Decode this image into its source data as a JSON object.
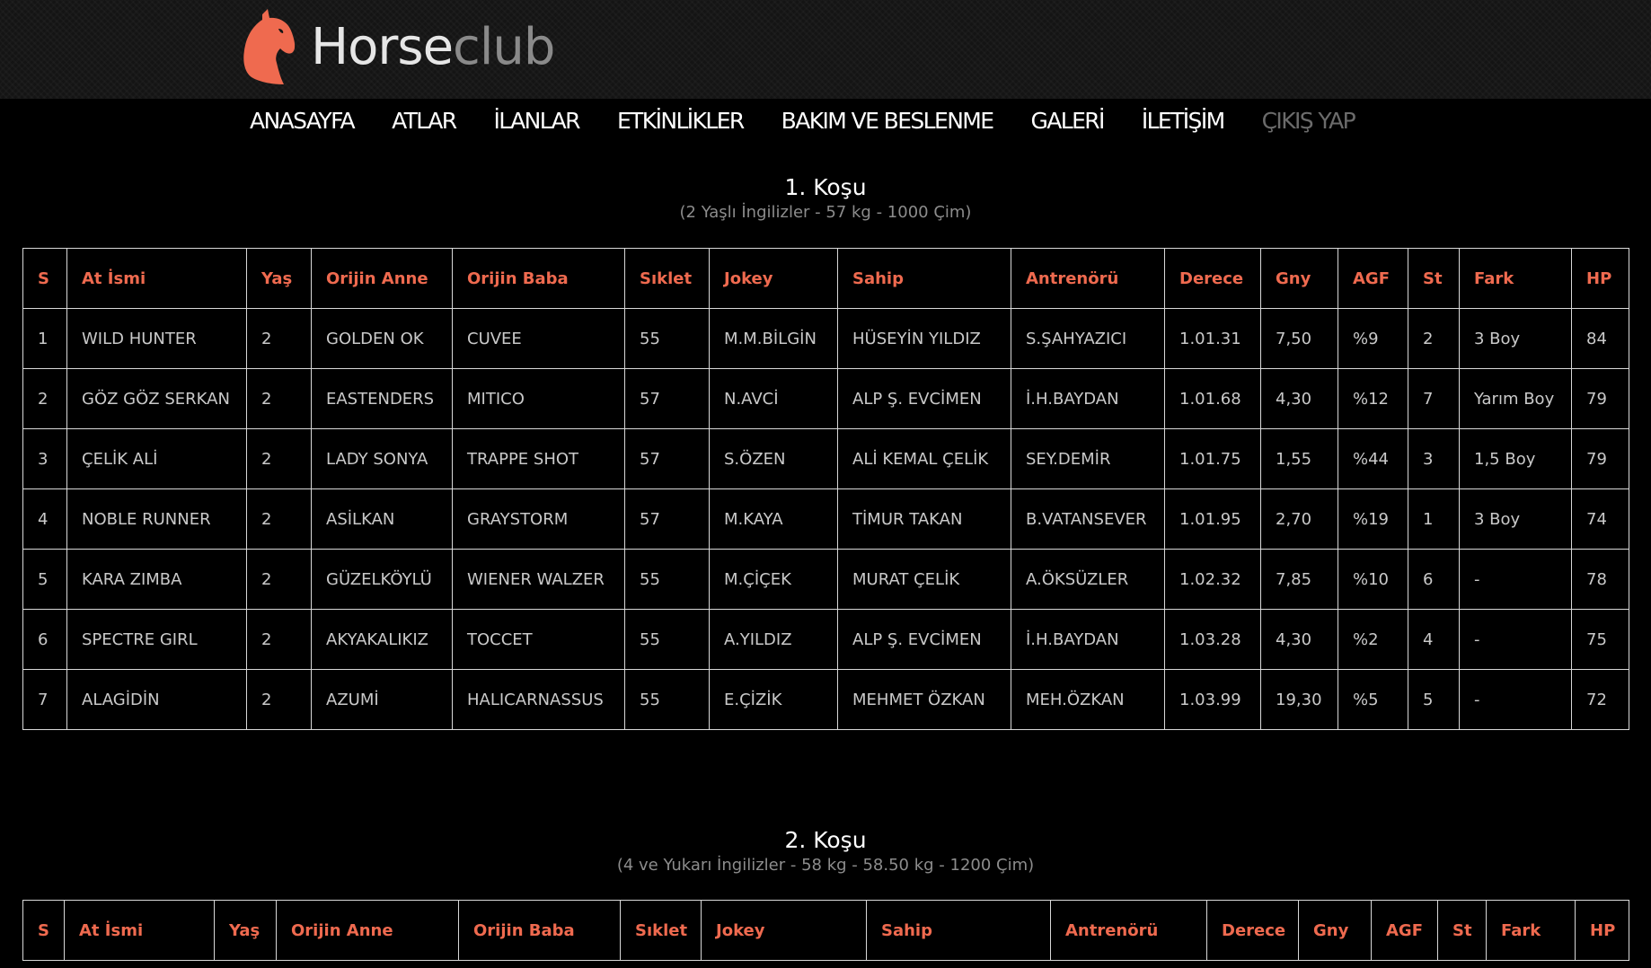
{
  "brand": {
    "name_part1": "Horse",
    "name_part2": "club",
    "accent_color": "#ef6a4f"
  },
  "nav": {
    "items": [
      {
        "label": "ANASAYFA"
      },
      {
        "label": "ATLAR"
      },
      {
        "label": "İLANLAR"
      },
      {
        "label": "ETKİNLİKLER"
      },
      {
        "label": "BAKIM VE BESLENME"
      },
      {
        "label": "GALERİ"
      },
      {
        "label": "İLETİŞİM"
      },
      {
        "label": "ÇIKIŞ YAP"
      }
    ]
  },
  "races": [
    {
      "title": "1. Koşu",
      "subtitle": "(2 Yaşlı İngilizler - 57 kg - 1000 Çim)",
      "headers": [
        "S",
        "At İsmi",
        "Yaş",
        "Orijin Anne",
        "Orijin Baba",
        "Sıklet",
        "Jokey",
        "Sahip",
        "Antrenörü",
        "Derece",
        "Gny",
        "AGF",
        "St",
        "Fark",
        "HP"
      ],
      "rows": [
        [
          "1",
          "WILD HUNTER",
          "2",
          "GOLDEN OK",
          "CUVEE",
          "55",
          "M.M.BİLGİN",
          "HÜSEYİN YILDIZ",
          "S.ŞAHYAZICI",
          "1.01.31",
          "7,50",
          "%9",
          "2",
          "3 Boy",
          "84"
        ],
        [
          "2",
          "GÖZ GÖZ SERKAN",
          "2",
          "EASTENDERS",
          "MITICO",
          "57",
          "N.AVCİ",
          "ALP Ş. EVCİMEN",
          "İ.H.BAYDAN",
          "1.01.68",
          "4,30",
          "%12",
          "7",
          "Yarım Boy",
          "79"
        ],
        [
          "3",
          "ÇELİK ALİ",
          "2",
          "LADY SONYA",
          "TRAPPE SHOT",
          "57",
          "S.ÖZEN",
          "ALİ KEMAL ÇELİK",
          "SEY.DEMİR",
          "1.01.75",
          "1,55",
          "%44",
          "3",
          "1,5 Boy",
          "79"
        ],
        [
          "4",
          "NOBLE RUNNER",
          "2",
          "ASİLKAN",
          "GRAYSTORM",
          "57",
          "M.KAYA",
          "TİMUR TAKAN",
          "B.VATANSEVER",
          "1.01.95",
          "2,70",
          "%19",
          "1",
          "3 Boy",
          "74"
        ],
        [
          "5",
          "KARA ZIMBA",
          "2",
          "GÜZELKÖYLÜ",
          "WIENER WALZER",
          "55",
          "M.ÇİÇEK",
          "MURAT ÇELİK",
          "A.ÖKSÜZLER",
          "1.02.32",
          "7,85",
          "%10",
          "6",
          "-",
          "78"
        ],
        [
          "6",
          "SPECTRE GIRL",
          "2",
          "AKYAKALIKIZ",
          "TOCCET",
          "55",
          "A.YILDIZ",
          "ALP Ş. EVCİMEN",
          "İ.H.BAYDAN",
          "1.03.28",
          "4,30",
          "%2",
          "4",
          "-",
          "75"
        ],
        [
          "7",
          "ALAGİDİN",
          "2",
          "AZUMİ",
          "HALICARNASSUS",
          "55",
          "E.ÇİZİK",
          "MEHMET ÖZKAN",
          "MEH.ÖZKAN",
          "1.03.99",
          "19,30",
          "%5",
          "5",
          "-",
          "72"
        ]
      ]
    },
    {
      "title": "2. Koşu",
      "subtitle": "(4 ve Yukarı İngilizler - 58 kg - 58.50 kg - 1200 Çim)",
      "headers": [
        "S",
        "At İsmi",
        "Yaş",
        "Orijin Anne",
        "Orijin Baba",
        "Sıklet",
        "Jokey",
        "Sahip",
        "Antrenörü",
        "Derece",
        "Gny",
        "AGF",
        "St",
        "Fark",
        "HP"
      ],
      "rows": []
    }
  ]
}
